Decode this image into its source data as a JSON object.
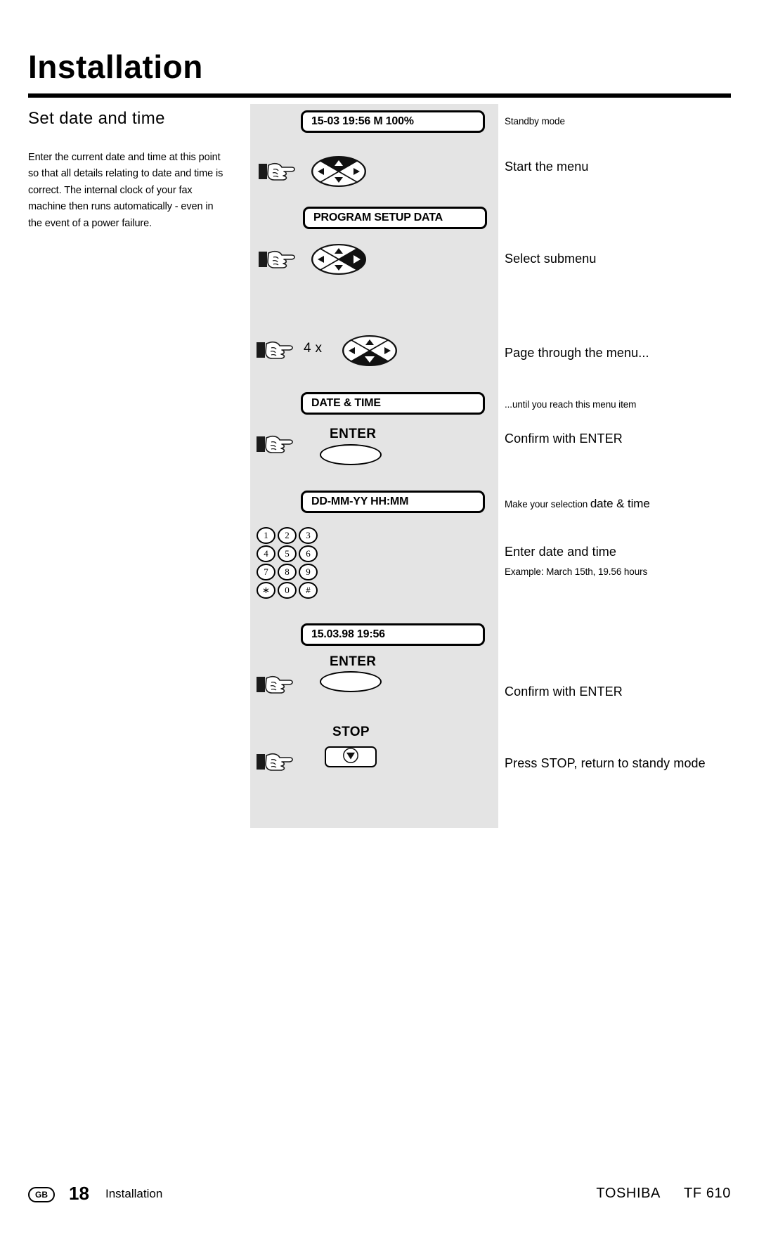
{
  "header": {
    "chapter_title": "Installation"
  },
  "left": {
    "section_title": "Set date and time",
    "body": "Enter the current date and time at this point so that all details relating to date and time is correct. The internal clock of your fax machine then runs automatically - even in the event of a power failure."
  },
  "steps": [
    {
      "id": "standby",
      "display": "15-03 19:56  M 100%",
      "note": "Standby mode",
      "note_size": "small"
    },
    {
      "id": "start-menu",
      "note": "Start the menu",
      "note_size": "big",
      "icon": "hand-pointing-icon",
      "control": "navigation-pad-up"
    },
    {
      "id": "program-setup",
      "display": "PROGRAM SETUP DATA"
    },
    {
      "id": "select-submenu",
      "note": "Select submenu",
      "note_size": "big",
      "icon": "hand-pointing-icon",
      "control": "navigation-pad-right"
    },
    {
      "id": "page-through",
      "repeat": "4 x",
      "note": "Page through the menu...",
      "note_size": "big",
      "icon": "hand-pointing-icon",
      "control": "navigation-pad-down"
    },
    {
      "id": "date-time-item",
      "display": "DATE & TIME",
      "note": "...until you reach this menu item",
      "note_size": "small"
    },
    {
      "id": "confirm-enter-1",
      "key_label": "ENTER",
      "note": "Confirm with ENTER",
      "note_size": "big",
      "icon": "hand-pointing-icon"
    },
    {
      "id": "format-prompt",
      "display": "DD-MM-YY HH:MM",
      "note_prefix": "Make your selection ",
      "note_emphasis": "date & time"
    },
    {
      "id": "enter-date-time",
      "note": "Enter date and time",
      "note_size": "big",
      "note_sub": "Example: March 15th, 19.56 hours",
      "control": "numeric-keypad"
    },
    {
      "id": "entered-value",
      "display": "15.03.98  19:56"
    },
    {
      "id": "confirm-enter-2",
      "key_label": "ENTER",
      "note": "Confirm with ENTER",
      "note_size": "big",
      "icon": "hand-pointing-icon"
    },
    {
      "id": "press-stop",
      "key_label": "STOP",
      "note": "Press STOP, return to standy mode",
      "note_size": "big",
      "icon": "hand-pointing-icon"
    }
  ],
  "keypad": {
    "rows": [
      [
        "1",
        "2",
        "3"
      ],
      [
        "4",
        "5",
        "6"
      ],
      [
        "7",
        "8",
        "9"
      ],
      [
        "∗",
        "0",
        "#"
      ]
    ]
  },
  "footer": {
    "region_badge": "GB",
    "page_number": "18",
    "page_label": "Installation",
    "brand": "TOSHIBA",
    "model": "TF 610"
  }
}
